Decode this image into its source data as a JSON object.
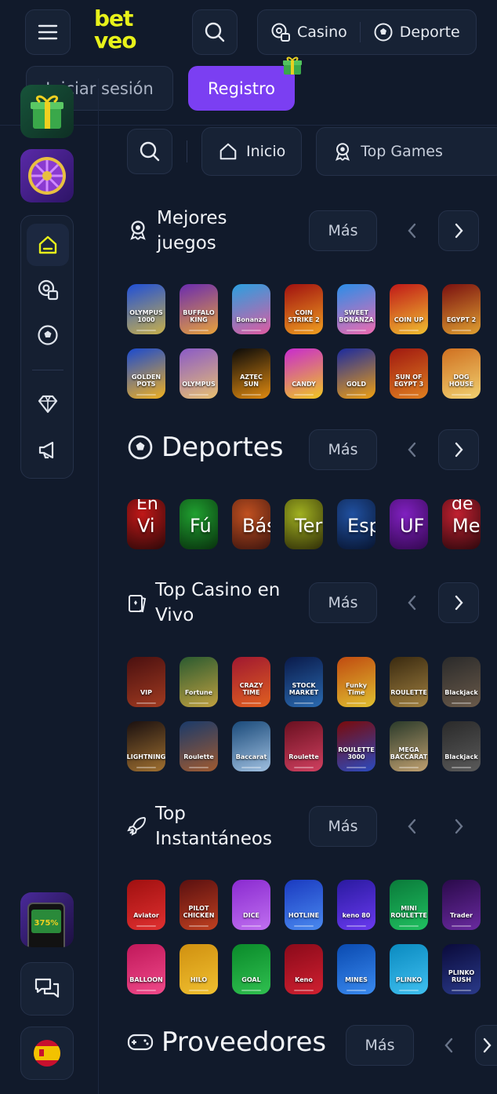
{
  "header": {
    "logo_top": "bet",
    "logo_bottom": "veo",
    "casino": "Casino",
    "deporte": "Deporte",
    "login": "Iniciar sesión",
    "register": "Registro"
  },
  "chips": [
    {
      "label": "Inicio",
      "icon": "home-icon"
    },
    {
      "label": "Top Games",
      "icon": "award-icon"
    }
  ],
  "sections": {
    "mejores": {
      "title": "Mejores juegos",
      "more": "Más"
    },
    "deportes": {
      "title": "Deportes",
      "more": "Más"
    },
    "casino_vivo": {
      "title": "Top Casino en Vivo",
      "more": "Más"
    },
    "instantaneos": {
      "title": "Top Instantáneos",
      "more": "Más"
    },
    "proveedores": {
      "title": "Proveedores",
      "more": "Más"
    }
  },
  "mejores_tiles": [
    {
      "label": "OLYMPUS 1000",
      "c1": "#1f4fd8",
      "c2": "#c8b04a"
    },
    {
      "label": "BUFFALO KING",
      "c1": "#6a2bb0",
      "c2": "#e8a23a"
    },
    {
      "label": "Bonanza",
      "c1": "#2aa0e0",
      "c2": "#e05aa0"
    },
    {
      "label": "COIN STRIKE 2",
      "c1": "#a01010",
      "c2": "#f0a020"
    },
    {
      "label": "SWEET BONANZA",
      "c1": "#2a8ee8",
      "c2": "#f06ab0"
    },
    {
      "label": "COIN UP",
      "c1": "#c01818",
      "c2": "#f0c030"
    },
    {
      "label": "EGYPT 2",
      "c1": "#7a1010",
      "c2": "#e0a030"
    },
    {
      "label": "GOLDEN POTS",
      "c1": "#1a4ad0",
      "c2": "#f0b020"
    },
    {
      "label": "OLYMPUS",
      "c1": "#8a5ac8",
      "c2": "#e8c070"
    },
    {
      "label": "AZTEC SUN",
      "c1": "#0a0a0a",
      "c2": "#e08a10"
    },
    {
      "label": "CANDY",
      "c1": "#c82ad0",
      "c2": "#f0c820"
    },
    {
      "label": "GOLD",
      "c1": "#1a2aa0",
      "c2": "#f0a010"
    },
    {
      "label": "SUN OF EGYPT 3",
      "c1": "#a01810",
      "c2": "#e08020"
    },
    {
      "label": "DOG HOUSE",
      "c1": "#d07020",
      "c2": "#f0d070"
    }
  ],
  "deportes_tiles": [
    {
      "label": "Vi",
      "label2": "En",
      "c1": "#3a0a0a",
      "c2": "#c01818"
    },
    {
      "label": "Fú",
      "label2": "",
      "c1": "#0a3a10",
      "c2": "#20a030"
    },
    {
      "label": "Bás",
      "label2": "",
      "c1": "#4a1a10",
      "c2": "#c05020"
    },
    {
      "label": "Ter",
      "label2": "",
      "c1": "#3a3a0a",
      "c2": "#a0b020"
    },
    {
      "label": "Esp",
      "label2": "",
      "c1": "#0a1a3a",
      "c2": "#2050a0"
    },
    {
      "label": "UF",
      "label2": "",
      "c1": "#3a0a5a",
      "c2": "#8020c0"
    },
    {
      "label": "Me",
      "label2": "de",
      "c1": "#3a0a10",
      "c2": "#c02030"
    }
  ],
  "vivo_tiles": [
    {
      "label": "VIP",
      "c1": "#4a1010",
      "c2": "#a03a20"
    },
    {
      "label": "Fortune",
      "c1": "#2a5a30",
      "c2": "#c0a040"
    },
    {
      "label": "CRAZY TIME",
      "c1": "#a01830",
      "c2": "#e06020"
    },
    {
      "label": "STOCK MARKET",
      "c1": "#0a1a4a",
      "c2": "#2a6ab0"
    },
    {
      "label": "Funky Time",
      "c1": "#c04a10",
      "c2": "#e0c030"
    },
    {
      "label": "ROULETTE",
      "c1": "#3a2a10",
      "c2": "#a08040"
    },
    {
      "label": "Blackjack",
      "c1": "#2a2a2a",
      "c2": "#6a5a4a"
    },
    {
      "label": "LIGHTNING",
      "c1": "#1a1010",
      "c2": "#a07030"
    },
    {
      "label": "Roulette",
      "c1": "#1a3a6a",
      "c2": "#a05a30"
    },
    {
      "label": "Baccarat",
      "c1": "#1a4a7a",
      "c2": "#a0c0e0"
    },
    {
      "label": "Roulette",
      "c1": "#6a1020",
      "c2": "#d04060"
    },
    {
      "label": "ROULETTE 3000",
      "c1": "#7a0a0a",
      "c2": "#2a4ac0"
    },
    {
      "label": "MEGA BACCARAT",
      "c1": "#2a3a2a",
      "c2": "#c0a070"
    },
    {
      "label": "Blackjack",
      "c1": "#2a2a2a",
      "c2": "#5a5a5a"
    }
  ],
  "instant_tiles": [
    {
      "label": "Aviator",
      "c1": "#a01010",
      "c2": "#e03030"
    },
    {
      "label": "PILOT CHICKEN",
      "c1": "#5a1010",
      "c2": "#c04020"
    },
    {
      "label": "DICE",
      "c1": "#8a2ad0",
      "c2": "#c070f0"
    },
    {
      "label": "HOTLINE",
      "c1": "#1a3ac0",
      "c2": "#4a8af0"
    },
    {
      "label": "keno 80",
      "c1": "#2a1aa0",
      "c2": "#6a3af0"
    },
    {
      "label": "MINI ROULETTE",
      "c1": "#0a7a3a",
      "c2": "#20c060"
    },
    {
      "label": "Trader",
      "c1": "#2a0a4a",
      "c2": "#6a2aa0"
    },
    {
      "label": "BALLOON",
      "c1": "#c0185a",
      "c2": "#f04a8a"
    },
    {
      "label": "HILO",
      "c1": "#d09010",
      "c2": "#f0c030"
    },
    {
      "label": "GOAL",
      "c1": "#0a8a2a",
      "c2": "#30c050"
    },
    {
      "label": "Keno",
      "c1": "#8a0a1a",
      "c2": "#d02030"
    },
    {
      "label": "MINES",
      "c1": "#0a4ab0",
      "c2": "#3a8af0"
    },
    {
      "label": "PLINKO",
      "c1": "#0a8ac0",
      "c2": "#40c0f0"
    },
    {
      "label": "PLINKO RUSH",
      "c1": "#0a0a3a",
      "c2": "#2a3a8a"
    }
  ],
  "colors": {
    "accent": "#7b3ff2",
    "logo": "#e8f21a",
    "bg": "#111a2b",
    "active_icon": "#e8f21a"
  }
}
